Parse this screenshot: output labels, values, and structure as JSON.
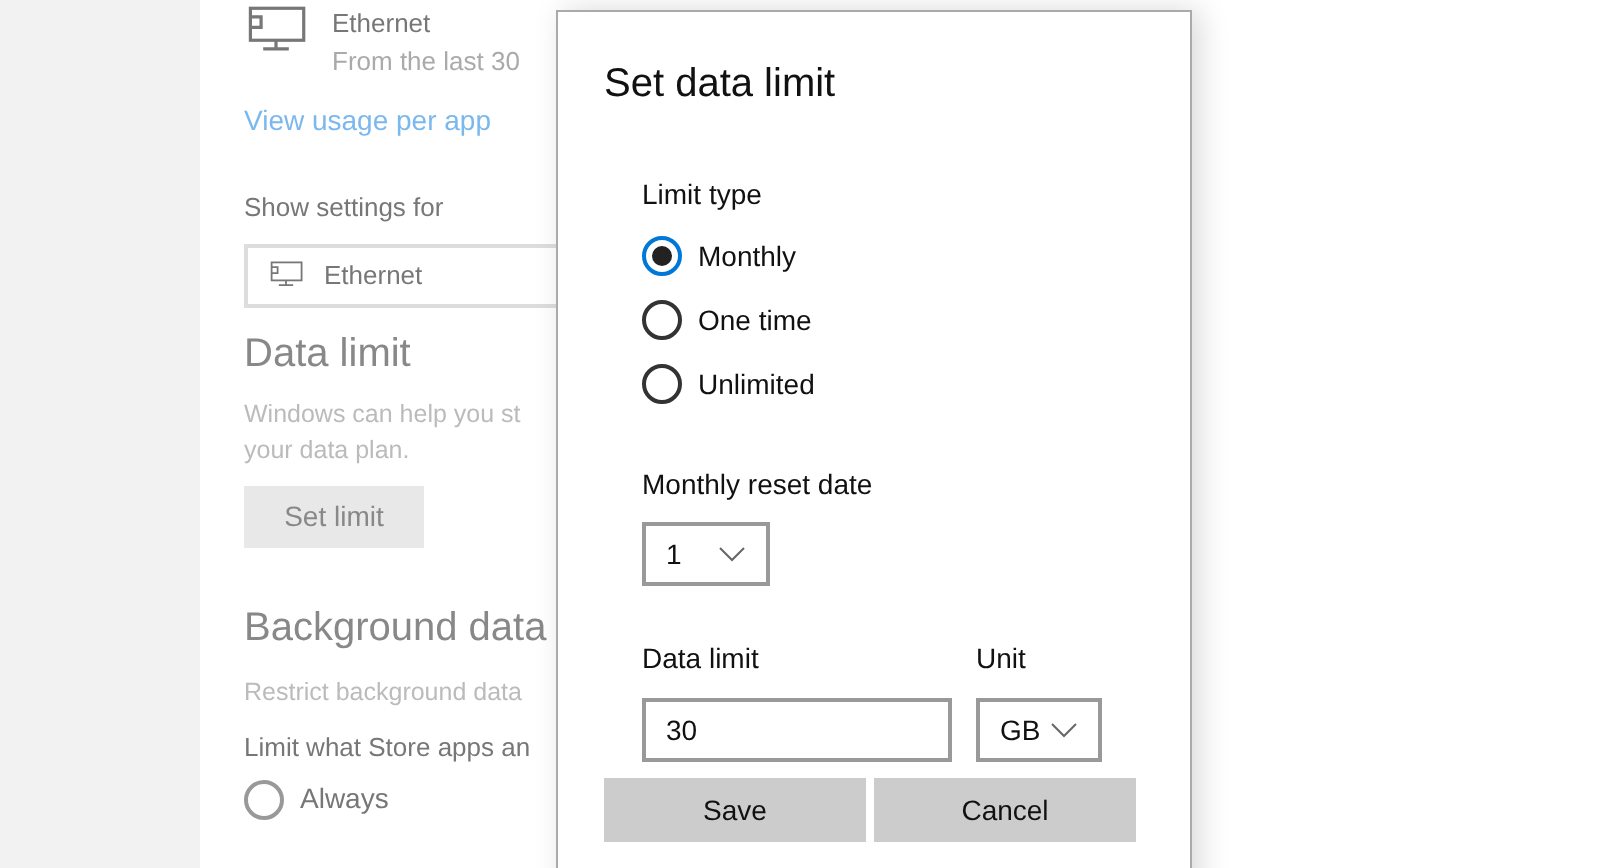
{
  "background": {
    "network": {
      "name": "Ethernet",
      "subtitle": "From the last 30"
    },
    "link": "View usage per app",
    "show_settings_label": "Show settings for",
    "show_settings_value": "Ethernet",
    "data_limit": {
      "heading": "Data limit",
      "description": [
        "Windows can help you st",
        "your data plan."
      ],
      "button": "Set limit"
    },
    "background_data": {
      "heading": "Background data",
      "description": "Restrict background data",
      "question": "Limit what Store apps an",
      "options": [
        {
          "label": "Always",
          "selected": false
        }
      ]
    }
  },
  "dialog": {
    "title": "Set data limit",
    "limit_type_label": "Limit type",
    "limit_types": [
      {
        "label": "Monthly",
        "selected": true
      },
      {
        "label": "One time",
        "selected": false
      },
      {
        "label": "Unlimited",
        "selected": false
      }
    ],
    "reset_date_label": "Monthly reset date",
    "reset_date": "1",
    "data_limit_label": "Data limit",
    "data_limit": "30",
    "unit_label": "Unit",
    "unit": "GB",
    "buttons": [
      "Save",
      "Cancel"
    ]
  }
}
